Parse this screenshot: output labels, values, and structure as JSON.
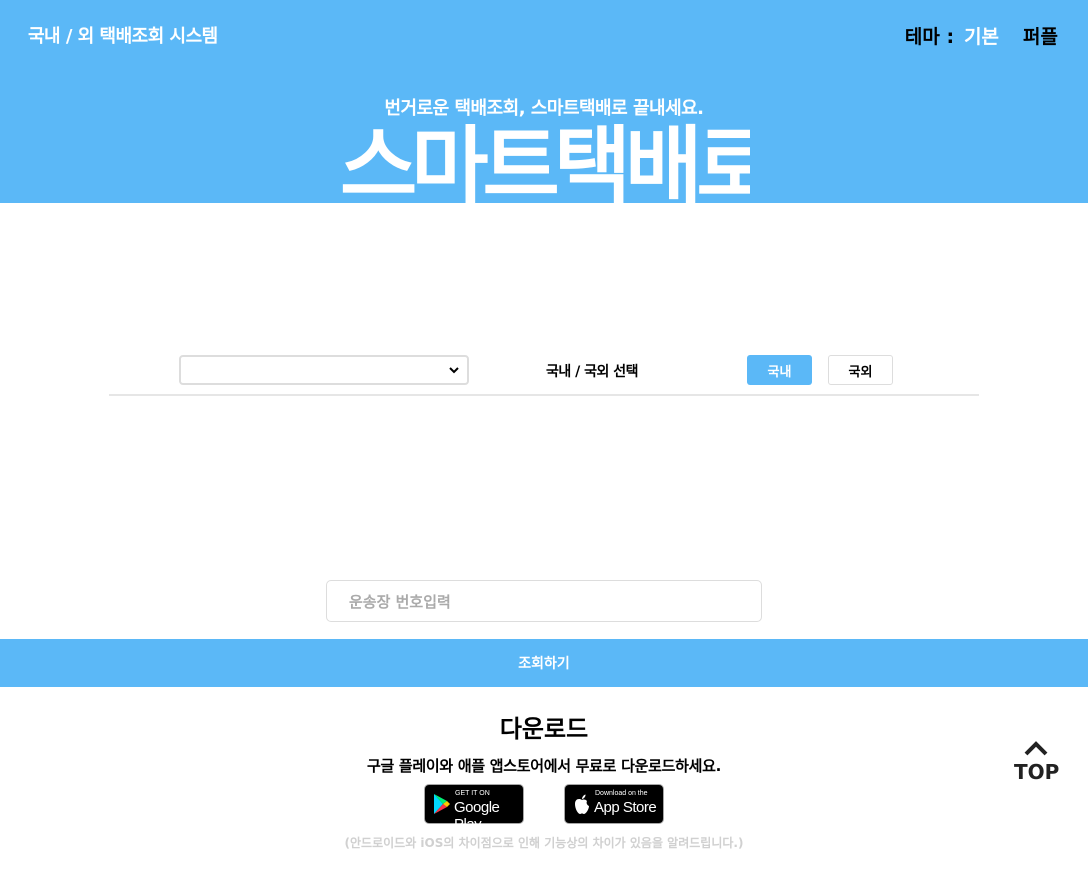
{
  "header": {
    "site_title": "국내 / 외 택배조회 시스템",
    "theme_label": "테마 :",
    "theme_options": [
      "기본",
      "퍼플"
    ],
    "tagline": "번거로운 택배조회, 스마트택배로 끝내세요.",
    "brand": "스마트택배로"
  },
  "selector": {
    "company_select_value": "",
    "region_label": "국내 / 국외 선택",
    "domestic_button": "국내",
    "international_button": "국외"
  },
  "search": {
    "tracking_placeholder": "운송장 번호입력",
    "submit_label": "조회하기"
  },
  "download": {
    "title": "다운로드",
    "description": "구글 플레이와 애플 앱스토어에서 무료로 다운로드하세요.",
    "google_small": "GET IT ON",
    "google_big": "Google Play",
    "apple_small": "Download on the",
    "apple_big": "App Store",
    "footnote": "(안드로이드와 iOS의 차이점으로 인해 기능상의 차이가 있음을 알려드립니다.)"
  },
  "top_button": {
    "label": "TOP"
  },
  "colors": {
    "accent": "#5bb8f7",
    "footnote": "#d0d0d0"
  }
}
